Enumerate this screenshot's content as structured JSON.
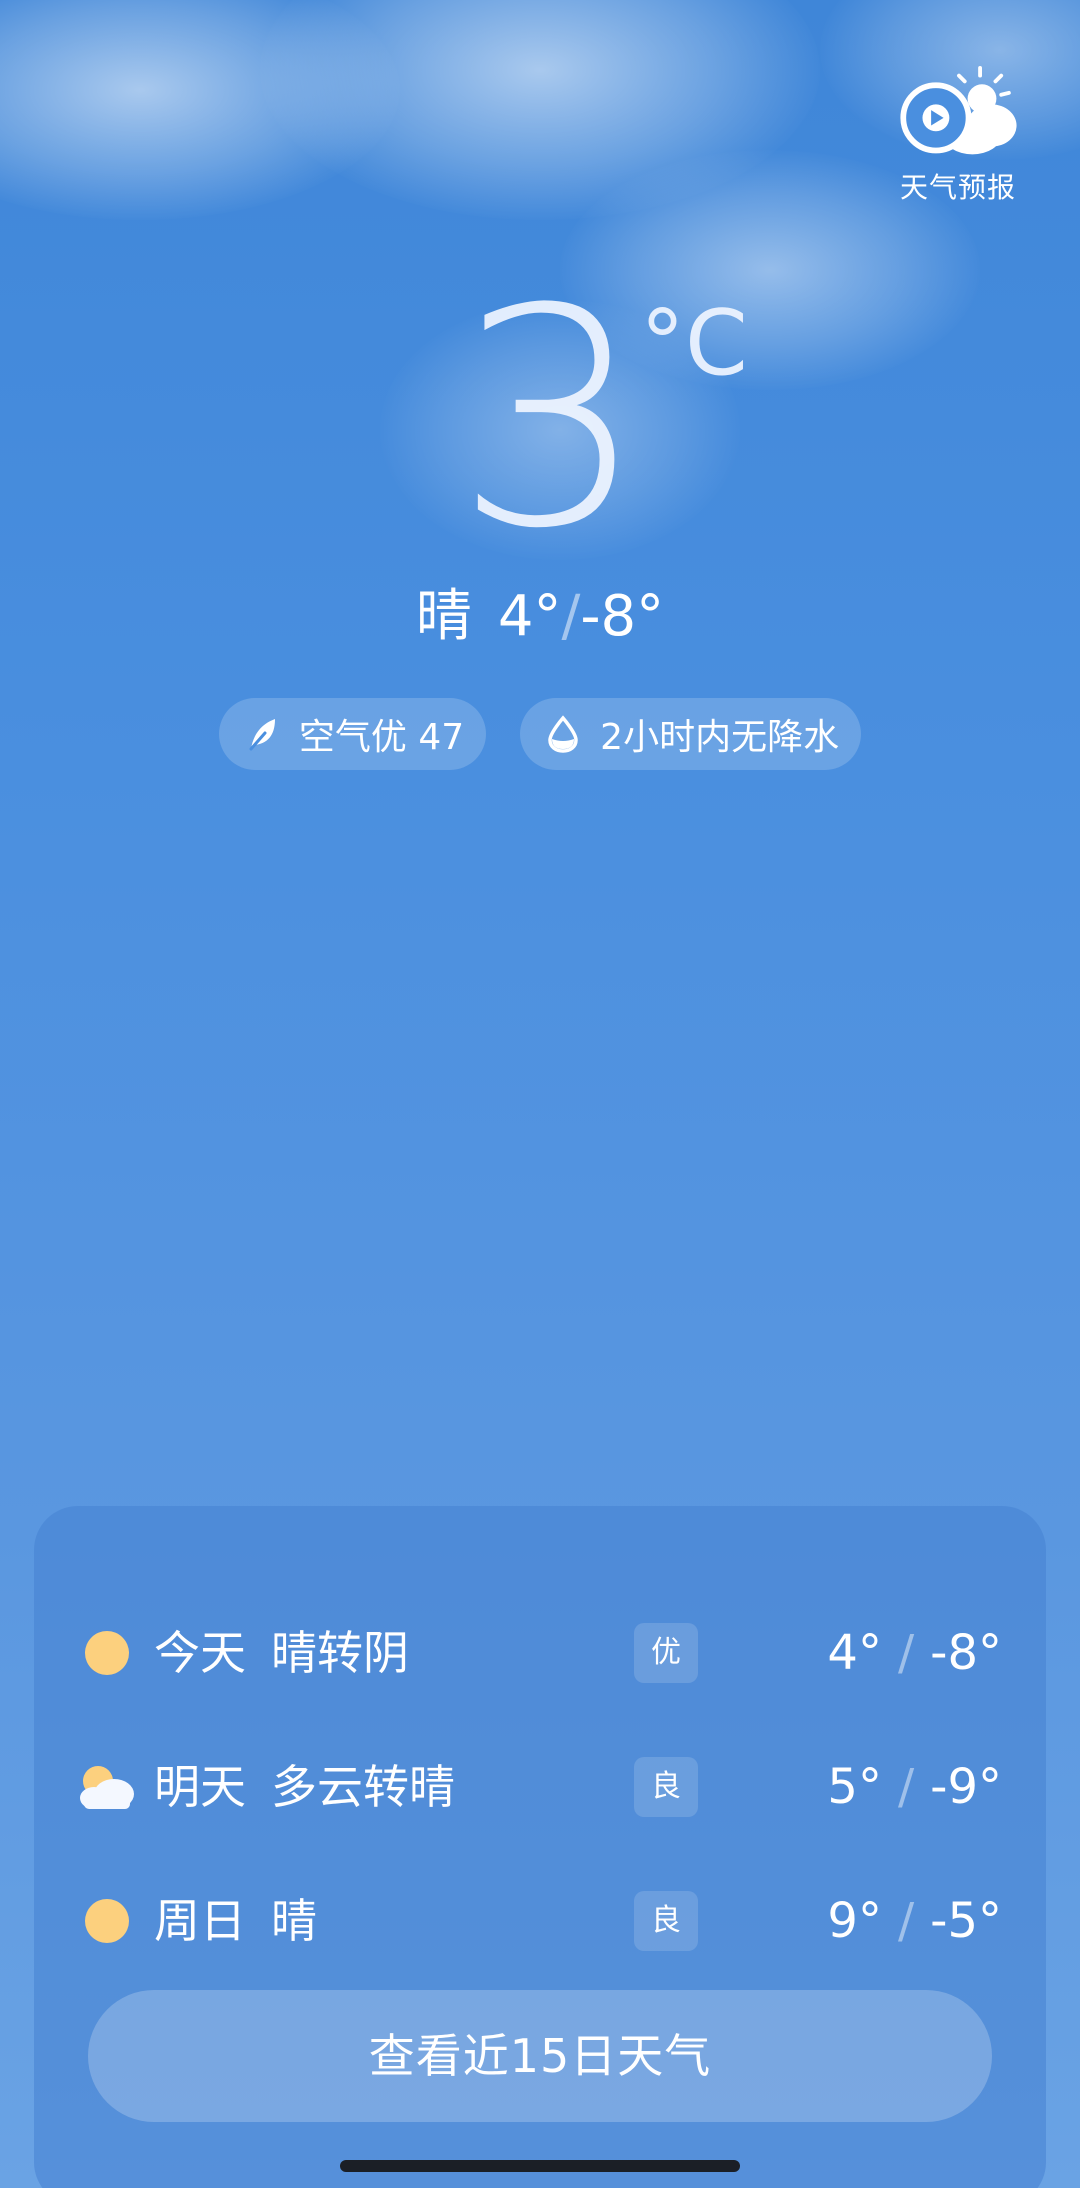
{
  "video_forecast": {
    "label": "天气预报"
  },
  "current": {
    "temperature": "3",
    "unit": "°C",
    "condition": "晴",
    "high": "4°",
    "low": "-8°",
    "separator": "/"
  },
  "pills": {
    "air_quality": "空气优 47",
    "precipitation": "2小时内无降水"
  },
  "forecast": [
    {
      "day": "今天",
      "desc": "晴转阴",
      "aqi": "优",
      "high": "4°",
      "low": "-8°",
      "icon": "sun-icon"
    },
    {
      "day": "明天",
      "desc": "多云转晴",
      "aqi": "良",
      "high": "5°",
      "low": "-9°",
      "icon": "partly-cloudy-icon"
    },
    {
      "day": "周日",
      "desc": "晴",
      "aqi": "良",
      "high": "9°",
      "low": "-5°",
      "icon": "sun-icon"
    }
  ],
  "cta": {
    "label": "查看近15日天气"
  },
  "colors": {
    "sky_top": "#3f86d8",
    "sky_bottom": "#6aa3e4",
    "sun": "#fcd07e"
  }
}
